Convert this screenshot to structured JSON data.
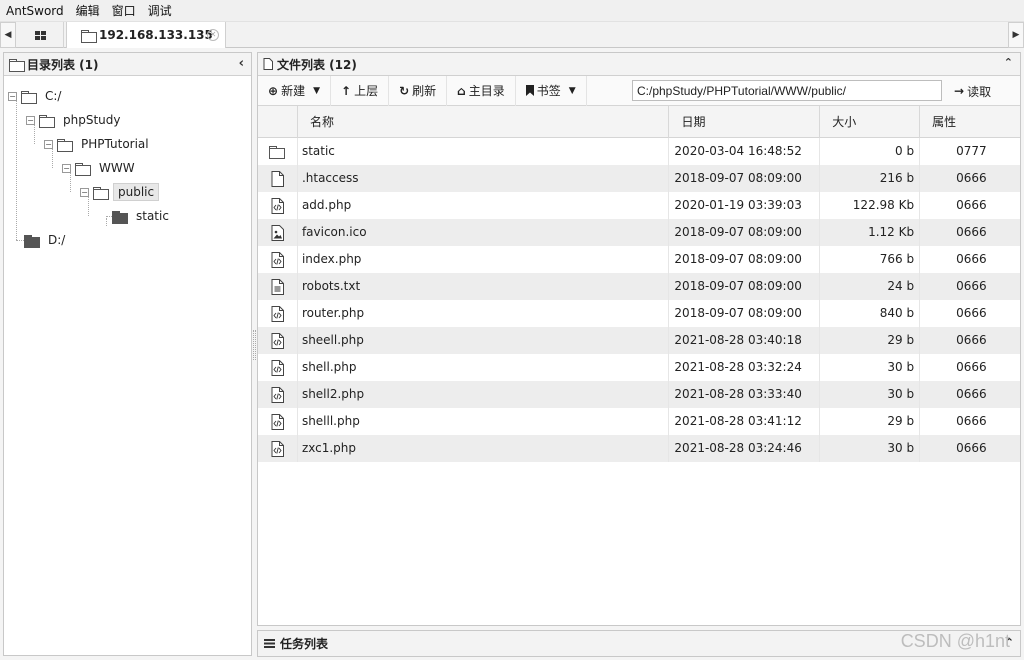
{
  "menu": [
    "AntSword",
    "编辑",
    "窗口",
    "调试"
  ],
  "tab": {
    "label": "192.168.133.135"
  },
  "tree_panel": {
    "title": "目录列表 (1)"
  },
  "tree": [
    {
      "label": "C:/",
      "toggle": "-",
      "filled": false,
      "selected": false
    },
    {
      "label": "phpStudy",
      "toggle": "-",
      "filled": false,
      "selected": false
    },
    {
      "label": "PHPTutorial",
      "toggle": "-",
      "filled": false,
      "selected": false
    },
    {
      "label": "WWW",
      "toggle": "-",
      "filled": false,
      "selected": false
    },
    {
      "label": "public",
      "toggle": "-",
      "filled": false,
      "selected": true
    },
    {
      "label": "static",
      "toggle": "",
      "filled": true,
      "selected": false
    },
    {
      "label": "D:/",
      "toggle": "",
      "filled": true,
      "selected": false
    }
  ],
  "file_panel": {
    "title": "文件列表 (12)"
  },
  "toolbar": {
    "new": "新建",
    "up": "上层",
    "refresh": "刷新",
    "home": "主目录",
    "bookmark": "书签",
    "path": "C:/phpStudy/PHPTutorial/WWW/public/",
    "read": "读取"
  },
  "columns": {
    "name": "名称",
    "date": "日期",
    "size": "大小",
    "attr": "属性"
  },
  "files": [
    {
      "name": "static",
      "date": "2020-03-04 16:48:52",
      "size": "0 b",
      "attr": "0777",
      "icon": "folder-icon"
    },
    {
      "name": ".htaccess",
      "date": "2018-09-07 08:09:00",
      "size": "216 b",
      "attr": "0666",
      "icon": "file-icon"
    },
    {
      "name": "add.php",
      "date": "2020-01-19 03:39:03",
      "size": "122.98 Kb",
      "attr": "0666",
      "icon": "code-file-icon"
    },
    {
      "name": "favicon.ico",
      "date": "2018-09-07 08:09:00",
      "size": "1.12 Kb",
      "attr": "0666",
      "icon": "image-file-icon"
    },
    {
      "name": "index.php",
      "date": "2018-09-07 08:09:00",
      "size": "766 b",
      "attr": "0666",
      "icon": "code-file-icon"
    },
    {
      "name": "robots.txt",
      "date": "2018-09-07 08:09:00",
      "size": "24 b",
      "attr": "0666",
      "icon": "text-file-icon"
    },
    {
      "name": "router.php",
      "date": "2018-09-07 08:09:00",
      "size": "840 b",
      "attr": "0666",
      "icon": "code-file-icon"
    },
    {
      "name": "sheell.php",
      "date": "2021-08-28 03:40:18",
      "size": "29 b",
      "attr": "0666",
      "icon": "code-file-icon"
    },
    {
      "name": "shell.php",
      "date": "2021-08-28 03:32:24",
      "size": "30 b",
      "attr": "0666",
      "icon": "code-file-icon"
    },
    {
      "name": "shell2.php",
      "date": "2021-08-28 03:33:40",
      "size": "30 b",
      "attr": "0666",
      "icon": "code-file-icon"
    },
    {
      "name": "shelll.php",
      "date": "2021-08-28 03:41:12",
      "size": "29 b",
      "attr": "0666",
      "icon": "code-file-icon"
    },
    {
      "name": "zxc1.php",
      "date": "2021-08-28 03:24:46",
      "size": "30 b",
      "attr": "0666",
      "icon": "code-file-icon"
    }
  ],
  "task_panel": {
    "title": "任务列表"
  },
  "watermark": "CSDN @h1nt"
}
